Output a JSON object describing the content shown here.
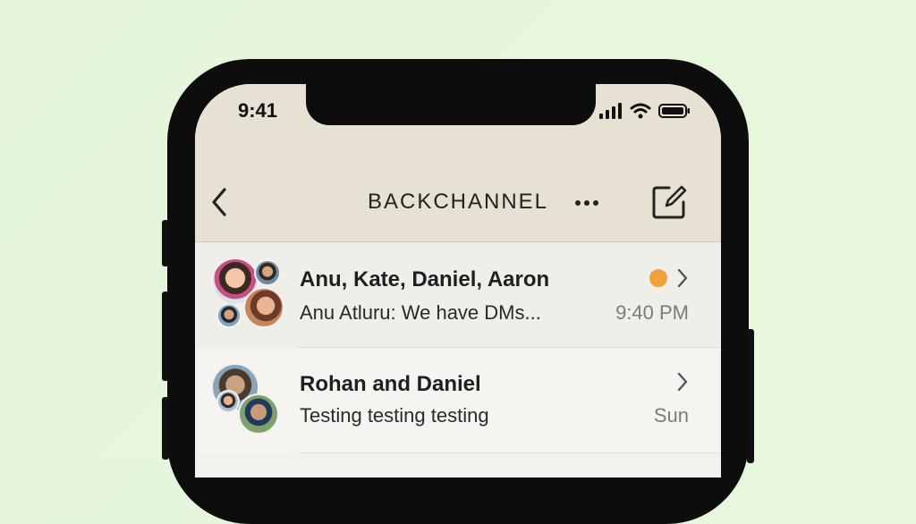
{
  "status_bar": {
    "time": "9:41"
  },
  "header": {
    "title": "BACKCHANNEL"
  },
  "icons": {
    "back": "chevron-left-icon",
    "more": "more-dots-icon",
    "compose": "compose-icon",
    "signal": "signal-icon",
    "wifi": "wifi-icon",
    "battery": "battery-icon"
  },
  "colors": {
    "background": "#e6f7dc",
    "header": "#e6e1d3",
    "unread_dot": "#f2a03a"
  },
  "conversations": [
    {
      "title": "Anu, Kate, Daniel, Aaron",
      "preview": "Anu Atluru: We have DMs...",
      "time": "9:40 PM",
      "unread": true
    },
    {
      "title": "Rohan and Daniel",
      "preview": "Testing testing testing",
      "time": "Sun",
      "unread": false
    }
  ]
}
